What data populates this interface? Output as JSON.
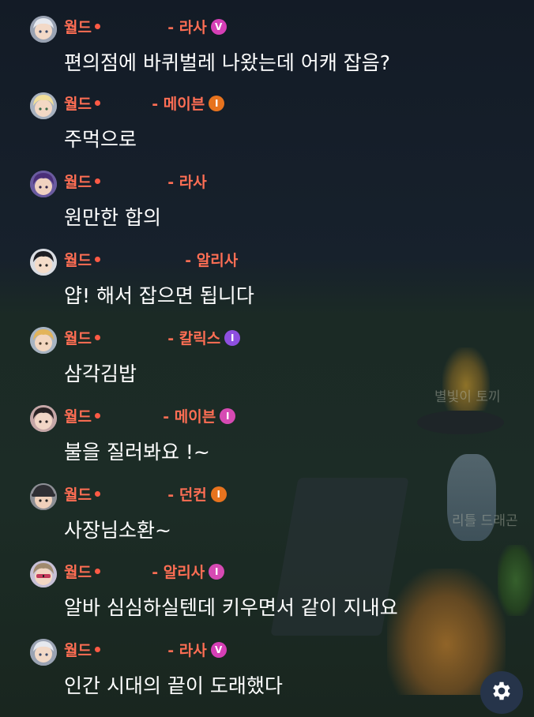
{
  "background_labels": [
    "별빛이 토끼",
    "리틀 드래곤"
  ],
  "messages": [
    {
      "prefix": "월드",
      "sep": "- ",
      "name": "라사",
      "badge": "V",
      "badge_color": "#d63fb6",
      "avatar": "white-hair-avatar",
      "text": "편의점에 바퀴벌레 나왔는데 어캐 잡음?"
    },
    {
      "prefix": "월드",
      "sep": "- ",
      "name": "메이븐",
      "badge": "I",
      "badge_color": "#e7731e",
      "avatar": "blonde-avatar",
      "text": "주먹으로"
    },
    {
      "prefix": "월드",
      "sep": "- ",
      "name": "라사",
      "badge": "",
      "badge_color": "",
      "avatar": "purple-hair-avatar",
      "text": "원만한 합의"
    },
    {
      "prefix": "월드",
      "sep": "- ",
      "name": "알리사",
      "badge": "",
      "badge_color": "",
      "avatar": "black-hair-avatar",
      "text": "얍! 해서 잡으면 됩니다"
    },
    {
      "prefix": "월드",
      "sep": "- ",
      "name": "칼릭스",
      "badge": "I",
      "badge_color": "#8e4fe0",
      "avatar": "gold-hair-avatar",
      "text": "삼각김밥"
    },
    {
      "prefix": "월드",
      "sep": "- ",
      "name": "메이븐",
      "badge": "I",
      "badge_color": "#d64ab3",
      "avatar": "dark-hair-avatar",
      "text": "불을 질러봐요 !~"
    },
    {
      "prefix": "월드",
      "sep": "- ",
      "name": "던컨",
      "badge": "I",
      "badge_color": "#e7731e",
      "avatar": "hat-avatar",
      "text": "사장님소환~"
    },
    {
      "prefix": "월드",
      "sep": "- ",
      "name": "알리사",
      "badge": "I",
      "badge_color": "#d64ab3",
      "avatar": "sunglasses-avatar",
      "text": "알바 심심하실텐데 키우면서 같이 지내요"
    },
    {
      "prefix": "월드",
      "sep": "- ",
      "name": "라사",
      "badge": "V",
      "badge_color": "#d63fb6",
      "avatar": "white-hair-avatar",
      "text": "인간 시대의 끝이 도래했다"
    }
  ],
  "settings_button": {
    "icon": "gear-icon"
  }
}
